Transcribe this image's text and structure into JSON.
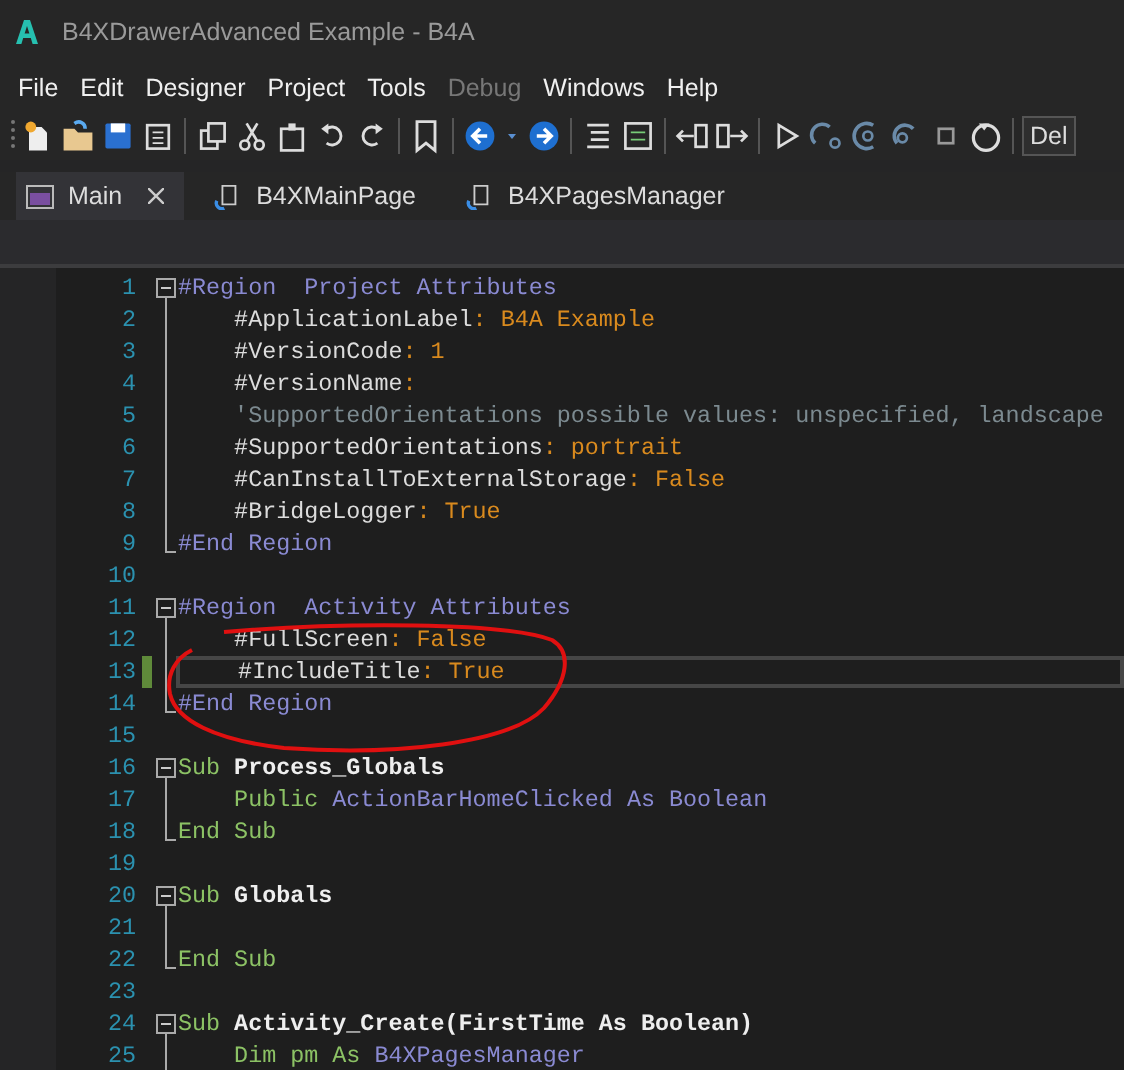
{
  "window": {
    "title": "B4XDrawerAdvanced Example - B4A"
  },
  "menu": [
    {
      "label": "File",
      "disabled": false
    },
    {
      "label": "Edit",
      "disabled": false
    },
    {
      "label": "Designer",
      "disabled": false
    },
    {
      "label": "Project",
      "disabled": false
    },
    {
      "label": "Tools",
      "disabled": false
    },
    {
      "label": "Debug",
      "disabled": true
    },
    {
      "label": "Windows",
      "disabled": false
    },
    {
      "label": "Help",
      "disabled": false
    }
  ],
  "toolbar": {
    "dropdown_value": "Del"
  },
  "tabs": [
    {
      "label": "Main",
      "selected": true,
      "closable": true
    },
    {
      "label": "B4XMainPage",
      "selected": false,
      "closable": false
    },
    {
      "label": "B4XPagesManager",
      "selected": false,
      "closable": false
    }
  ],
  "editor": {
    "lines": [
      {
        "number": "1",
        "kind": "fold_start",
        "current": false,
        "tokens": [
          {
            "t": "#Region  Project Attributes",
            "kind": "region"
          }
        ]
      },
      {
        "number": "2",
        "kind": "fold_body",
        "current": false,
        "tokens": [
          {
            "t": "    #ApplicationLabel",
            "kind": "attr"
          },
          {
            "t": ": B4A Example",
            "kind": "val"
          }
        ]
      },
      {
        "number": "3",
        "kind": "fold_body",
        "current": false,
        "tokens": [
          {
            "t": "    #VersionCode",
            "kind": "attr"
          },
          {
            "t": ": 1",
            "kind": "val"
          }
        ]
      },
      {
        "number": "4",
        "kind": "fold_body",
        "current": false,
        "tokens": [
          {
            "t": "    #VersionName",
            "kind": "attr"
          },
          {
            "t": ":",
            "kind": "val"
          }
        ]
      },
      {
        "number": "5",
        "kind": "fold_body",
        "current": false,
        "tokens": [
          {
            "t": "    'SupportedOrientations possible values: unspecified, landscape",
            "kind": "comment"
          }
        ]
      },
      {
        "number": "6",
        "kind": "fold_body",
        "current": false,
        "tokens": [
          {
            "t": "    #SupportedOrientations",
            "kind": "attr"
          },
          {
            "t": ": portrait",
            "kind": "val"
          }
        ]
      },
      {
        "number": "7",
        "kind": "fold_body",
        "current": false,
        "tokens": [
          {
            "t": "    #CanInstallToExternalStorage",
            "kind": "attr"
          },
          {
            "t": ": False",
            "kind": "val"
          }
        ]
      },
      {
        "number": "8",
        "kind": "fold_body",
        "current": false,
        "tokens": [
          {
            "t": "    #BridgeLogger",
            "kind": "attr"
          },
          {
            "t": ": True",
            "kind": "val"
          }
        ]
      },
      {
        "number": "9",
        "kind": "fold_end",
        "current": false,
        "tokens": [
          {
            "t": "#End Region",
            "kind": "region"
          }
        ]
      },
      {
        "number": "10",
        "kind": "plain",
        "current": false
      },
      {
        "number": "11",
        "kind": "fold_start",
        "current": false,
        "tokens": [
          {
            "t": "#Region  Activity Attributes",
            "kind": "region"
          }
        ]
      },
      {
        "number": "12",
        "kind": "fold_body",
        "current": false,
        "tokens": [
          {
            "t": "    #FullScreen",
            "kind": "attr"
          },
          {
            "t": ": False",
            "kind": "val"
          }
        ]
      },
      {
        "number": "13",
        "kind": "fold_body",
        "current": true,
        "tokens": [
          {
            "t": "    #IncludeTitle",
            "kind": "attr"
          },
          {
            "t": ": True",
            "kind": "val"
          }
        ]
      },
      {
        "number": "14",
        "kind": "fold_end",
        "current": false,
        "tokens": [
          {
            "t": "#End Region",
            "kind": "region"
          }
        ]
      },
      {
        "number": "15",
        "kind": "plain",
        "current": false
      },
      {
        "number": "16",
        "kind": "fold_start",
        "current": false,
        "tokens": [
          {
            "t": "Sub",
            "kind": "kw"
          },
          {
            "t": " Process_Globals",
            "kind": "name"
          }
        ]
      },
      {
        "number": "17",
        "kind": "fold_body",
        "current": false,
        "tokens": [
          {
            "t": "    Public",
            "kind": "kw"
          },
          {
            "t": " ActionBarHomeClicked As Boolean",
            "kind": "type"
          }
        ]
      },
      {
        "number": "18",
        "kind": "fold_end",
        "current": false,
        "tokens": [
          {
            "t": "End Sub",
            "kind": "kw"
          }
        ]
      },
      {
        "number": "19",
        "kind": "plain",
        "current": false
      },
      {
        "number": "20",
        "kind": "fold_start",
        "current": false,
        "tokens": [
          {
            "t": "Sub",
            "kind": "kw"
          },
          {
            "t": " Globals",
            "kind": "name"
          }
        ]
      },
      {
        "number": "21",
        "kind": "fold_body",
        "current": false
      },
      {
        "number": "22",
        "kind": "fold_end",
        "current": false,
        "tokens": [
          {
            "t": "End Sub",
            "kind": "kw"
          }
        ]
      },
      {
        "number": "23",
        "kind": "plain",
        "current": false
      },
      {
        "number": "24",
        "kind": "fold_start",
        "current": false,
        "tokens": [
          {
            "t": "Sub",
            "kind": "kw"
          },
          {
            "t": " Activity_Create(FirstTime As Boolean)",
            "kind": "name"
          }
        ]
      },
      {
        "number": "25",
        "kind": "fold_body",
        "current": false,
        "tokens": [
          {
            "t": "    Dim pm As",
            "kind": "kw"
          },
          {
            "t": " B4XPagesManager",
            "kind": "type"
          }
        ]
      }
    ]
  }
}
